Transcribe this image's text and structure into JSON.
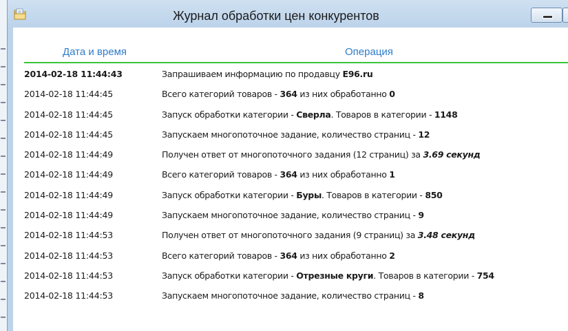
{
  "window": {
    "title": "Журнал обработки цен конкурентов",
    "icon": "folder-icon"
  },
  "columns": {
    "date": "Дата и время",
    "operation": "Операция"
  },
  "accent_colors": {
    "header_text": "#2d7cc9",
    "header_rule": "#37c43a"
  },
  "rows": [
    {
      "datetime": "2014-02-18 11:44:43",
      "parts": [
        {
          "t": "Запрашиваем информацию по продавцу "
        },
        {
          "t": "E96.ru",
          "b": true
        }
      ]
    },
    {
      "datetime": "2014-02-18 11:44:45",
      "parts": [
        {
          "t": "Всего категорий товаров - "
        },
        {
          "t": "364",
          "b": true
        },
        {
          "t": " из них обработанно "
        },
        {
          "t": "0",
          "b": true
        }
      ]
    },
    {
      "datetime": "2014-02-18 11:44:45",
      "parts": [
        {
          "t": "Запуск обработки категории - "
        },
        {
          "t": "Сверла",
          "b": true
        },
        {
          "t": ". Товаров в категории - "
        },
        {
          "t": "1148",
          "b": true
        }
      ]
    },
    {
      "datetime": "2014-02-18 11:44:45",
      "parts": [
        {
          "t": "Запускаем многопоточное задание, количество страниц - "
        },
        {
          "t": "12",
          "b": true
        }
      ]
    },
    {
      "datetime": "2014-02-18 11:44:49",
      "parts": [
        {
          "t": "Получен ответ от многопоточного задания (12 страниц) за "
        },
        {
          "t": "3.69 секунд",
          "i": true
        }
      ]
    },
    {
      "datetime": "2014-02-18 11:44:49",
      "parts": [
        {
          "t": "Всего категорий товаров - "
        },
        {
          "t": "364",
          "b": true
        },
        {
          "t": " из них обработанно "
        },
        {
          "t": "1",
          "b": true
        }
      ]
    },
    {
      "datetime": "2014-02-18 11:44:49",
      "parts": [
        {
          "t": "Запуск обработки категории - "
        },
        {
          "t": "Буры",
          "b": true
        },
        {
          "t": ". Товаров в категории - "
        },
        {
          "t": "850",
          "b": true
        }
      ]
    },
    {
      "datetime": "2014-02-18 11:44:49",
      "parts": [
        {
          "t": "Запускаем многопоточное задание, количество страниц - "
        },
        {
          "t": "9",
          "b": true
        }
      ]
    },
    {
      "datetime": "2014-02-18 11:44:53",
      "parts": [
        {
          "t": "Получен ответ от многопоточного задания (9 страниц) за "
        },
        {
          "t": "3.48 секунд",
          "i": true
        }
      ]
    },
    {
      "datetime": "2014-02-18 11:44:53",
      "parts": [
        {
          "t": "Всего категорий товаров - "
        },
        {
          "t": "364",
          "b": true
        },
        {
          "t": " из них обработанно "
        },
        {
          "t": "2",
          "b": true
        }
      ]
    },
    {
      "datetime": "2014-02-18 11:44:53",
      "parts": [
        {
          "t": "Запуск обработки категории - "
        },
        {
          "t": "Отрезные круги",
          "b": true
        },
        {
          "t": ". Товаров в категории - "
        },
        {
          "t": "754",
          "b": true
        }
      ]
    },
    {
      "datetime": "2014-02-18 11:44:53",
      "parts": [
        {
          "t": "Запускаем многопоточное задание, количество страниц - "
        },
        {
          "t": "8",
          "b": true
        }
      ]
    }
  ]
}
